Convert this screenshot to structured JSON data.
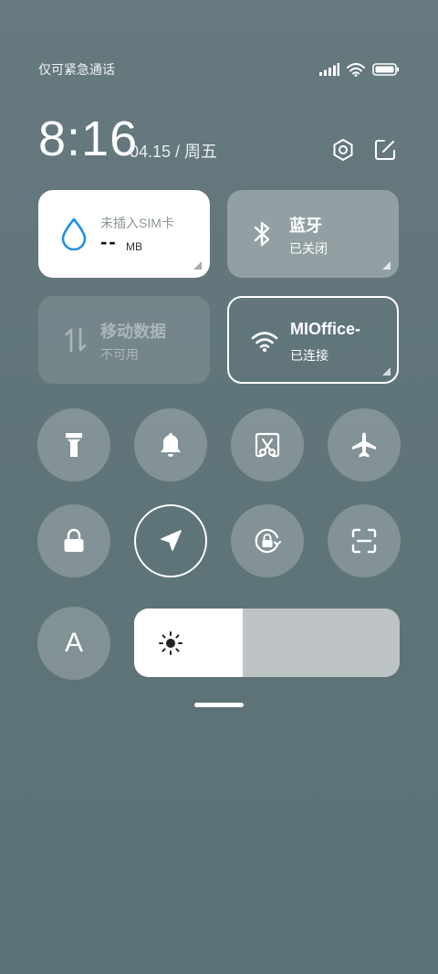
{
  "status": {
    "carrier": "仅可紧急通话",
    "icons": [
      "signal-icon",
      "wifi-icon",
      "battery-icon"
    ]
  },
  "header": {
    "time": "8:16",
    "date": "04.15 / 周五",
    "icons": [
      "settings-icon",
      "edit-icon"
    ]
  },
  "tiles": {
    "data_usage": {
      "label": "未插入SIM卡",
      "value": "--",
      "unit": "MB",
      "icon": "water-drop-icon"
    },
    "bluetooth": {
      "title": "蓝牙",
      "status": "已关闭",
      "icon": "bluetooth-icon"
    },
    "mobile_data": {
      "title": "移动数据",
      "status": "不可用",
      "icon": "data-arrows-icon"
    },
    "wifi": {
      "title": "MIOffice-",
      "status": "已连接",
      "icon": "wifi-icon"
    }
  },
  "toggles": [
    "flashlight-icon",
    "bell-icon",
    "screenshot-icon",
    "airplane-icon",
    "lock-icon",
    "location-icon",
    "rotation-lock-icon",
    "scan-icon"
  ],
  "font_button": {
    "label": "A"
  },
  "brightness": {
    "level": 0.41,
    "icon": "sun-icon"
  },
  "colors": {
    "accent_blue": "#1e90e0",
    "tile_active": "#ffffff",
    "tile_inactive": "#8b9a9d"
  }
}
